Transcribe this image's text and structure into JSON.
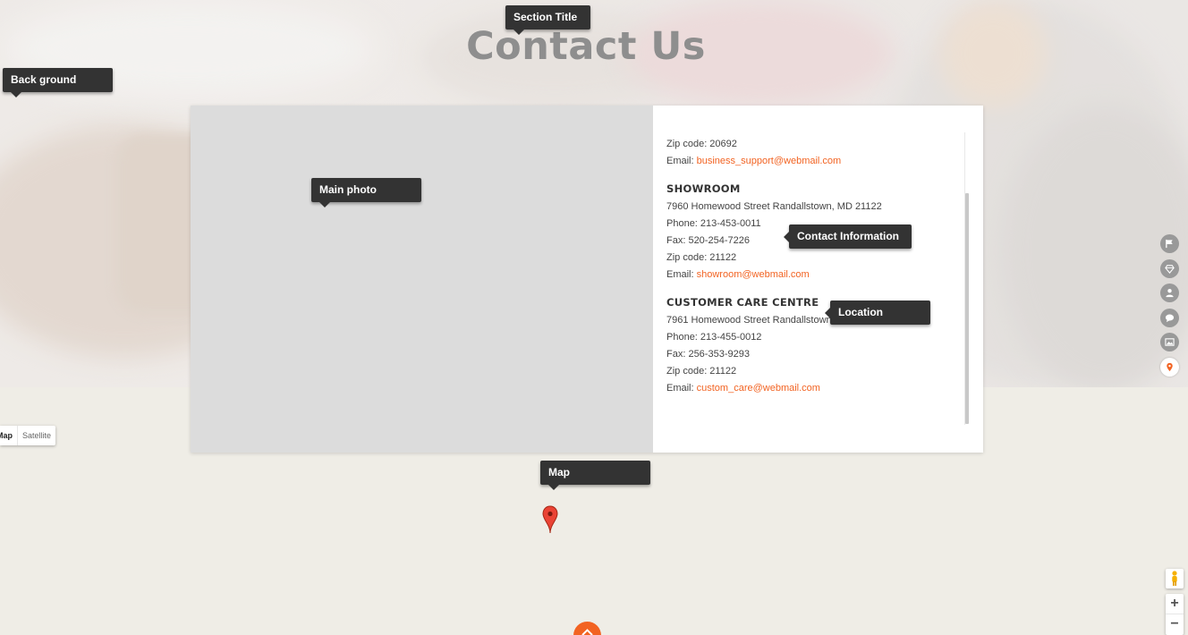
{
  "page": {
    "title": "Contact Us"
  },
  "annotations": {
    "section_title": "Section Title",
    "background": "Back ground",
    "main_photo": "Main photo",
    "contact_information": "Contact Information",
    "location": "Location",
    "map": "Map"
  },
  "contact": {
    "head_office_partial": {
      "zip": "Zip code: 20692",
      "email_label": "Email:",
      "email": "business_support@webmail.com"
    },
    "showroom": {
      "heading": "SHOWROOM",
      "address": "7960 Homewood Street Randallstown, MD 21122",
      "phone": "Phone: 213-453-0011",
      "fax": "Fax: 520-254-7226",
      "zip": "Zip code: 21122",
      "email_label": "Email:",
      "email": "showroom@webmail.com"
    },
    "customer_care": {
      "heading": "CUSTOMER CARE CENTRE",
      "address": "7961 Homewood Street Randallstown, MD 21122",
      "phone": "Phone: 213-455-0012",
      "fax": "Fax: 256-353-9293",
      "zip": "Zip code: 21122",
      "email_label": "Email:",
      "email": "custom_care@webmail.com"
    }
  },
  "map": {
    "type_buttons": [
      "Map",
      "Satellite"
    ],
    "zoom_in": "+",
    "zoom_out": "−"
  },
  "side_nav": {
    "items": [
      {
        "icon": "flag-icon"
      },
      {
        "icon": "diamond-icon"
      },
      {
        "icon": "user-icon"
      },
      {
        "icon": "chat-icon"
      },
      {
        "icon": "image-icon"
      },
      {
        "icon": "location-pin-icon",
        "active": true
      }
    ]
  },
  "colors": {
    "accent": "#f26322",
    "title": "#8e8e8e",
    "photo_placeholder": "#dcdcdc",
    "map_bg": "#efede6",
    "tooltip_bg": "#333333"
  }
}
